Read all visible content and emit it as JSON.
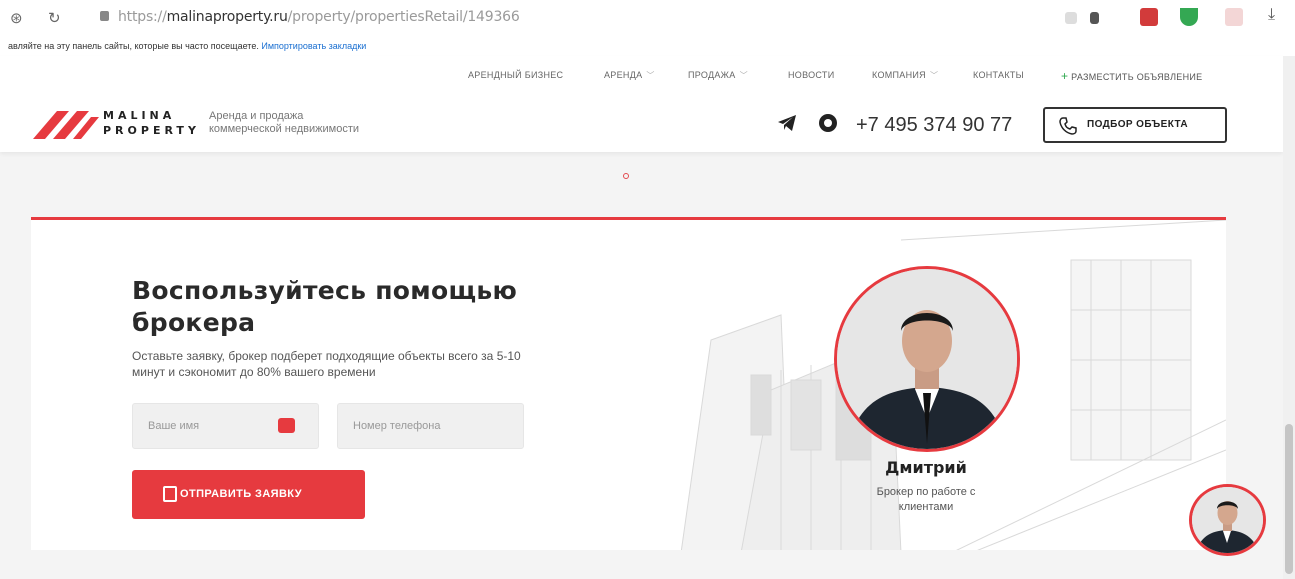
{
  "browser": {
    "url_prefix": "https://",
    "url_domain": "malinaproperty.ru",
    "url_path": "/property/propertiesRetail/149366",
    "bookmarks_text": "авляйте на эту панель сайты, которые вы часто посещаете.",
    "bookmarks_link": "Импортировать закладки"
  },
  "header": {
    "menu": [
      {
        "label": "АРЕНДНЫЙ БИЗНЕС",
        "chevron": false
      },
      {
        "label": "АРЕНДА",
        "chevron": true
      },
      {
        "label": "ПРОДАЖА",
        "chevron": true
      },
      {
        "label": "НОВОСТИ",
        "chevron": false
      },
      {
        "label": "КОМПАНИЯ",
        "chevron": true
      },
      {
        "label": "КОНТАКТЫ",
        "chevron": false
      }
    ],
    "post_ad": "РАЗМЕСТИТЬ ОБЪЯВЛЕНИЕ",
    "post_ad_plus": "+",
    "logo_line1": "MALINA",
    "logo_line2": "PROPERTY",
    "tagline1": "Аренда и продажа",
    "tagline2": "коммерческой недвижимости",
    "phone": "+7 495 374 90 77",
    "select_button": "ПОДБОР ОБЪЕКТА"
  },
  "card": {
    "title_line1": "Воспользуйтесь помощью",
    "title_line2": "брокера",
    "subtitle_line1": "Оставьте заявку, брокер подберет подходящие объекты всего за 5-10",
    "subtitle_line2": "минут и сэкономит до 80% вашего времени",
    "name_placeholder": "Ваше имя",
    "phone_placeholder": "Номер телефона",
    "submit": "ОТПРАВИТЬ ЗАЯВКУ",
    "broker_name": "Дмитрий",
    "broker_role_line1": "Брокер по работе с",
    "broker_role_line2": "клиентами"
  },
  "icons": {
    "telegram": "telegram-icon",
    "whatsapp": "whatsapp-icon",
    "phone": "phone-icon",
    "document": "document-icon"
  },
  "colors": {
    "accent": "#e63a3f",
    "text": "#222222"
  }
}
